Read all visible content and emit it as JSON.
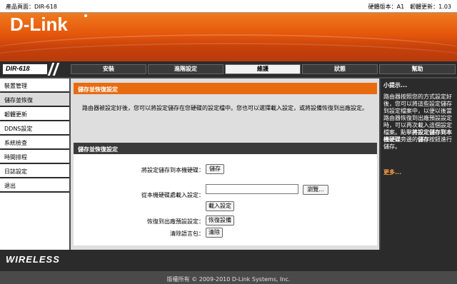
{
  "topbar": {
    "product": "產品頁面：DIR-618",
    "versions": "硬體版本：A1　韌體更新：1.03"
  },
  "brand": {
    "logo": "D-Link",
    "model": "DIR-618",
    "wireless": "WIRELESS"
  },
  "nav": {
    "tabs": [
      {
        "label": "安裝"
      },
      {
        "label": "進階設定"
      },
      {
        "label": "維護"
      },
      {
        "label": "狀態"
      },
      {
        "label": "幫助"
      }
    ],
    "active_tab": "維護"
  },
  "sidebar": {
    "items": [
      {
        "label": "裝置管理"
      },
      {
        "label": "儲存並恢復"
      },
      {
        "label": "韌體更新"
      },
      {
        "label": "DDNS設定"
      },
      {
        "label": "系統檢查"
      },
      {
        "label": "時間排程"
      },
      {
        "label": "日誌設定"
      },
      {
        "label": "退出"
      }
    ],
    "active_item": "儲存並恢復"
  },
  "intro": {
    "title": "儲存並恢復設定",
    "text": "路由器被設定好後，您可以將設定儲存在您硬碟的設定檔中。您也可以選擇載入設定，或將設備恢復到出廠設定。"
  },
  "form": {
    "title": "儲存並恢復設定",
    "save_label": "將設定儲存到本機硬碟：",
    "save_button": "儲存",
    "load_label": "從本機硬碟處載入設定：",
    "file_value": "",
    "browse_button": "瀏覽...",
    "load_button": "載入設定",
    "restore_label": "恢復到出廠預設設定：",
    "restore_button": "恢復設備",
    "clear_label": "清除語言包：",
    "clear_button": "清除"
  },
  "hints": {
    "title": "小提示...",
    "text_part1": "路由器按照您的方式設定好後，您可以將這些設定儲存到設定檔案中，以便以後當路由器恢復到出廠預設設定時，可以再次載入這個設定檔案。點擊",
    "text_bold": "將設定儲存到本機硬碟",
    "text_part2": "旁邊的",
    "text_bold2": "儲存",
    "text_part3": "按鈕進行儲存。",
    "more": "更多..."
  },
  "footer": {
    "copyright": "版權所有 © 2009-2010 D-Link Systems, Inc."
  },
  "colors": {
    "accent": "#e96b10",
    "dark": "#2b2b2b",
    "panel_gray": "#dedede",
    "link": "#ffa040"
  }
}
